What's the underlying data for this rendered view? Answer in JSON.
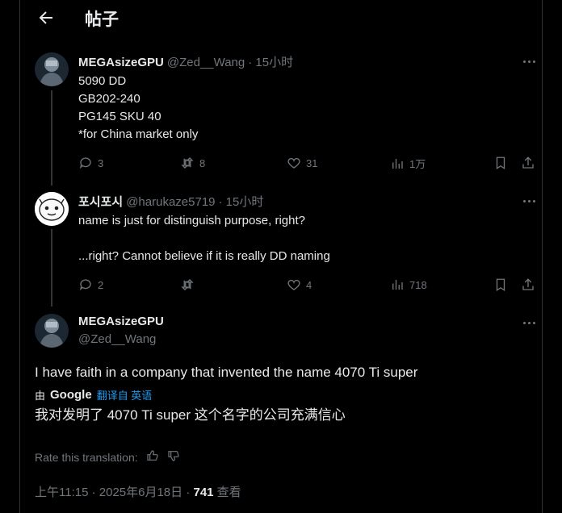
{
  "header": {
    "title": "帖子"
  },
  "tweet1": {
    "name": "MEGAsizeGPU",
    "handle": "@Zed__Wang",
    "time": "· 15小时",
    "text": "5090 DD\nGB202-240\nPG145 SKU 40\n*for China market only",
    "replies": "3",
    "retweets": "8",
    "likes": "31",
    "views": "1万"
  },
  "tweet2": {
    "name": "포시포시",
    "handle": "@harukaze5719",
    "time": "· 15小时",
    "text": "name is just for distinguish purpose, right?\n\n...right? Cannot believe if it is really DD naming",
    "replies": "2",
    "retweets": "",
    "likes": "4",
    "views": "718"
  },
  "main": {
    "name": "MEGAsizeGPU",
    "handle": "@Zed__Wang",
    "text": "I have faith in a company that invented the name 4070 Ti super",
    "translate_prefix": "由",
    "translate_brand": "Google",
    "translate_action": "翻译自 英语",
    "translation": "我对发明了 4070 Ti super 这个名字的公司充满信心",
    "rate_label": "Rate this translation:",
    "meta_time": "上午11:15 · 2025年6月18日 · ",
    "views_count": "741",
    "views_label": " 查看"
  },
  "colors": {
    "background": "#000000",
    "text": "#e7e9ea",
    "muted": "#71767b",
    "link": "#1d9bf0",
    "divider": "#2f3336"
  }
}
